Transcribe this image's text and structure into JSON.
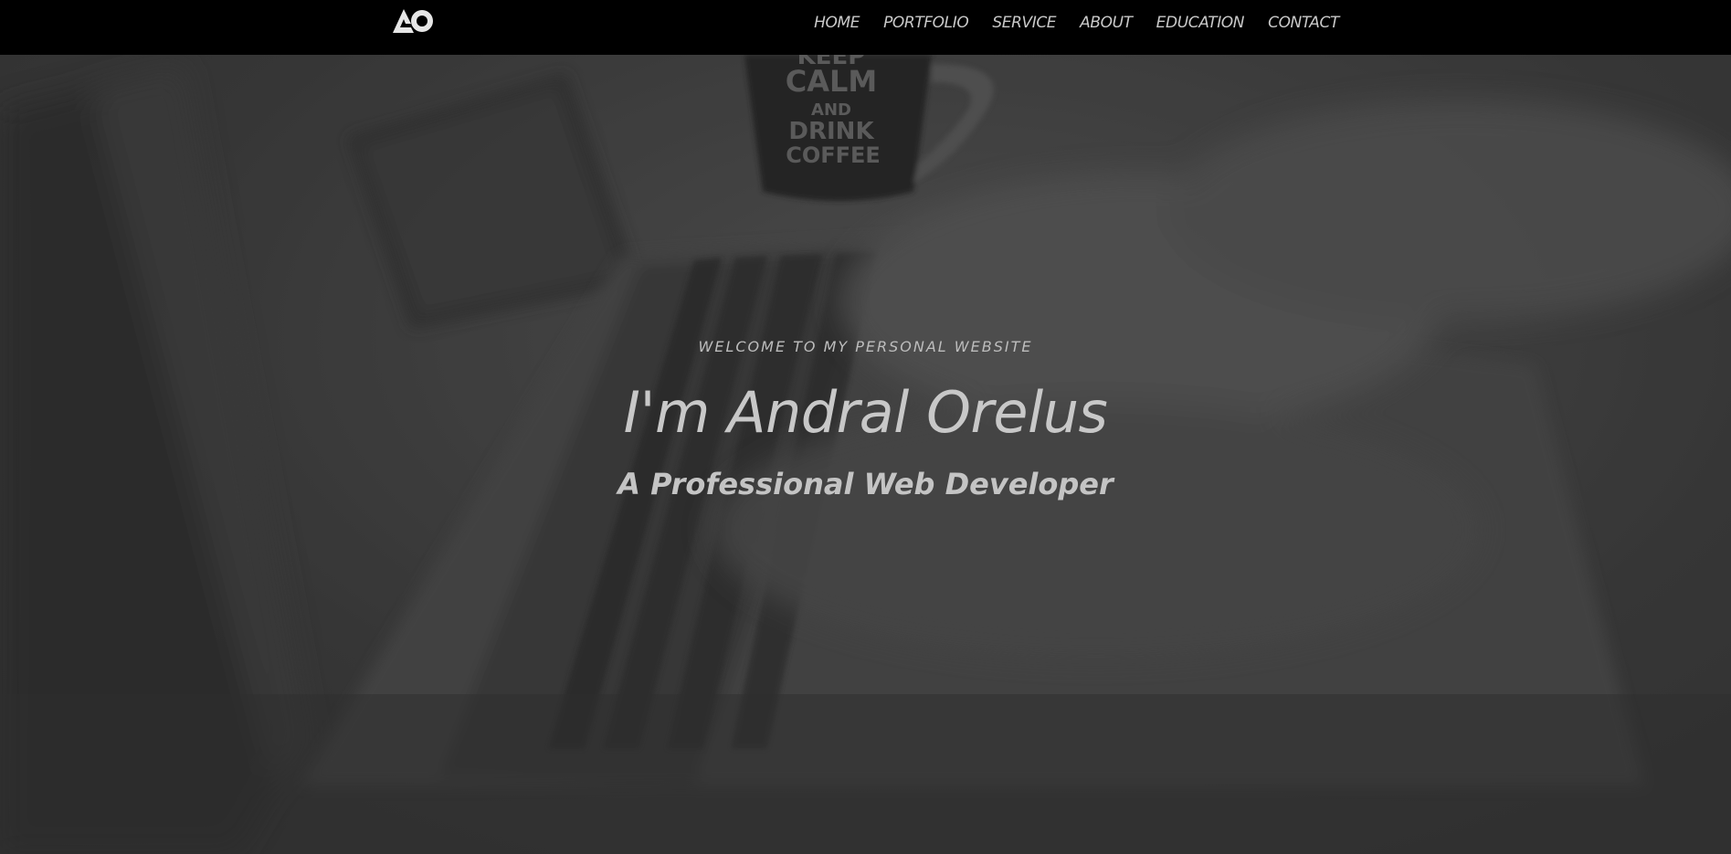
{
  "logo": {
    "icon": "ao-monogram-icon",
    "color": "#e6e6e6"
  },
  "nav": {
    "items": [
      {
        "label": "HOME"
      },
      {
        "label": "PORTFOLIO"
      },
      {
        "label": "SERVICE"
      },
      {
        "label": "ABOUT"
      },
      {
        "label": "EDUCATION"
      },
      {
        "label": "CONTACT"
      }
    ]
  },
  "hero": {
    "welcome": "WELCOME TO MY PERSONAL WEBSITE",
    "name": "I'm Andral Orelus",
    "tagline": "A Professional Web Developer",
    "mug_text": [
      "KEEP",
      "CALM",
      "AND",
      "DRINK",
      "COFFEE"
    ]
  },
  "colors": {
    "navbar_bg": "#000000",
    "nav_text": "#c9c9c9",
    "hero_text": "#c8c8c8",
    "hero_overlay": "#3a3a3a"
  }
}
